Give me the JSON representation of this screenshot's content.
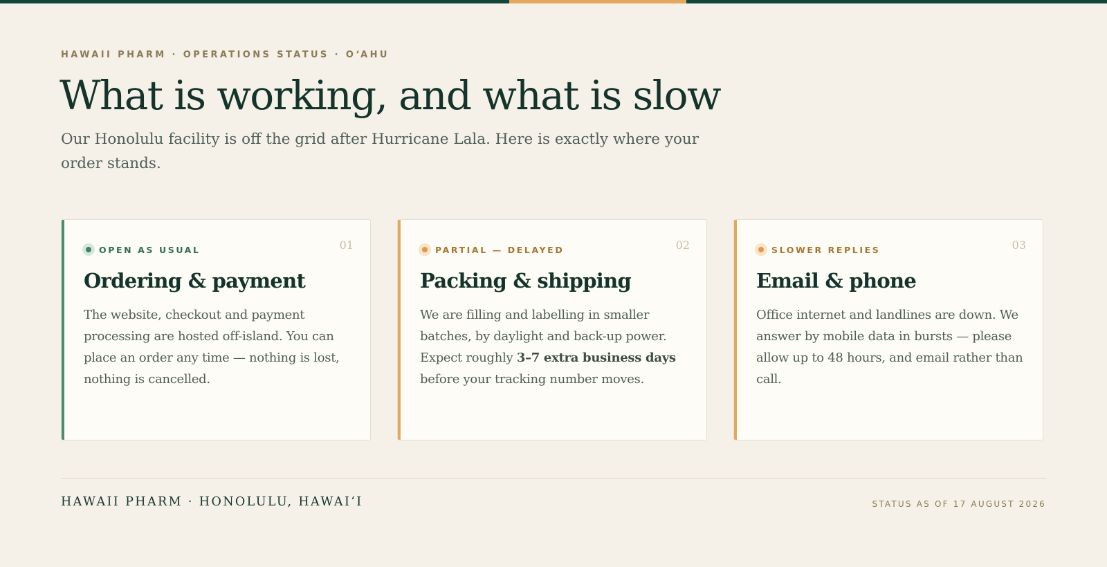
{
  "header": {
    "eyebrow": "HAWAII PHARM · OPERATIONS STATUS · O‘AHU",
    "title": "What is working, and what is slow",
    "subtitle": "Our Honolulu facility is off the grid after Hurricane Lala. Here is exactly where your order stands."
  },
  "colors": {
    "accent_green": "#4a8f6d",
    "accent_amber": "#e3a85c",
    "status_green_text": "#2f6e54",
    "status_amber_text": "#a87530",
    "top_bar": "#14453a"
  },
  "cards": [
    {
      "status": "OPEN AS USUAL",
      "number": "01",
      "title": "Ordering & payment",
      "body": "The website, checkout and payment processing are hosted off-island. You can place an order any time — nothing is lost, nothing is cancelled."
    },
    {
      "status": "PARTIAL — DELAYED",
      "number": "02",
      "title": "Packing & shipping",
      "body_before": "We are filling and labelling in smaller batches, by daylight and back-up power. Expect roughly ",
      "body_strong": "3–7 extra business days",
      "body_after": " before your tracking number moves."
    },
    {
      "status": "SLOWER REPLIES",
      "number": "03",
      "title": "Email & phone",
      "body": "Office internet and landlines are down. We answer by mobile data in bursts — please allow up to 48 hours, and email rather than call."
    }
  ],
  "footer": {
    "brand": "HAWAII PHARM · HONOLULU, HAWAI‘I",
    "status_date": "STATUS AS OF 17 AUGUST 2026"
  }
}
